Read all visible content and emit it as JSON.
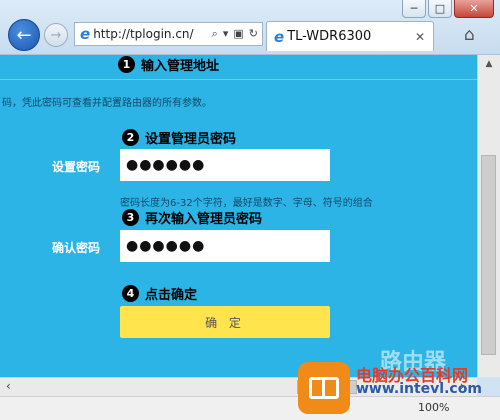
{
  "browser": {
    "address": "http://tplogin.cn/",
    "tab_title": "TL-WDR6300",
    "tab_close": "✕",
    "zoom": "100%",
    "window_buttons": {
      "minimize": "─",
      "maximize": "□",
      "close": "✕"
    }
  },
  "page": {
    "step1": {
      "num": "1",
      "text": "输入管理地址"
    },
    "description": "码，凭此密码可查看并配置路由器的所有参数。",
    "step2": {
      "num": "2",
      "text": "设置管理员密码"
    },
    "set_password_label": "设置密码",
    "set_password_value": "●●●●●●",
    "hint": "密码长度为6-32个字符，最好是数字、字母、符号的组合",
    "step3": {
      "num": "3",
      "text": "再次输入管理员密码"
    },
    "confirm_password_label": "确认密码",
    "confirm_password_value": "●●●●●●",
    "step4": {
      "num": "4",
      "text": "点击确定"
    },
    "confirm_button": "确 定"
  },
  "watermark": {
    "faint_text": "路由器",
    "line1": "电脑办公百科网",
    "line2": "www.intevl.com"
  },
  "colors": {
    "page_bg": "#2bb4e5",
    "button_bg": "#ffe44d"
  }
}
